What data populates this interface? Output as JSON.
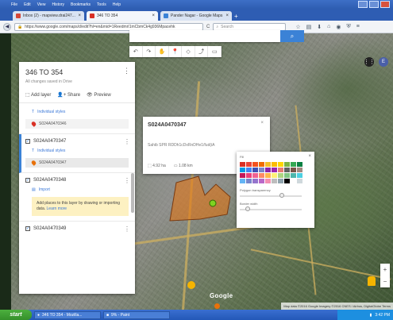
{
  "browser": {
    "menu_items": [
      "File",
      "Edit",
      "View",
      "History",
      "Bookmarks",
      "Tools",
      "Help"
    ],
    "tabs": [
      {
        "label": "Inbox (2) - mapview.drai247...",
        "color": "#d44638",
        "active": false
      },
      {
        "label": "346 TO 354",
        "color": "#d93025",
        "active": true
      },
      {
        "label": "Pander Nagar - Google Maps",
        "color": "#3b82d6",
        "active": false
      }
    ],
    "new_tab": "+",
    "url": "https://www.google.com/maps/d/edit?hl=en&mid=1ReedmrI1mCbmCk4g936Mpacehk",
    "search_placeholder": "Search",
    "reload": "C"
  },
  "panel": {
    "title": "346 TO 354",
    "subtitle": "All changes saved in Drive",
    "actions": {
      "add_layer": "Add layer",
      "share": "Share",
      "preview": "Preview"
    },
    "menu": "⋮",
    "layers": [
      {
        "name": "",
        "rows": [
          {
            "type": "link",
            "label": "Individual styles"
          },
          {
            "type": "item",
            "label": "S024A0470346",
            "pin": "#d93025"
          }
        ]
      },
      {
        "name": "S024A0470347",
        "selected": true,
        "rows": [
          {
            "type": "link",
            "label": "Individual styles"
          },
          {
            "type": "item",
            "label": "S024A0470347",
            "pin": "#e8710a"
          }
        ]
      },
      {
        "name": "S024A0470348",
        "rows": [
          {
            "type": "link",
            "label": "Import"
          }
        ],
        "tip": "Add places to this layer by drawing or importing data.",
        "tip_link": "Learn more"
      },
      {
        "name": "S024A0470349",
        "rows": []
      }
    ]
  },
  "map_toolbar": [
    "↶",
    "↷",
    "✋",
    "📍",
    "◇",
    "⤴",
    "▭"
  ],
  "map_controls": {
    "avatar": "E",
    "apps": "⋮⋮",
    "zoom_in": "+",
    "zoom_out": "−"
  },
  "info": {
    "title": "S024A0470347",
    "subtitle": "Sahib SPR RDDh1cDxRnDHe1/fud(iA",
    "area": "4.92 ha",
    "perimeter": "1.08 km",
    "edit_icon": "✎"
  },
  "picker": {
    "label": "Fill",
    "close": "×",
    "transparency_label": "Polygon transparency",
    "border_label": "Border width",
    "transparency_value": 0.7,
    "border_value": 0.1,
    "colors": [
      "#d93025",
      "#ea4335",
      "#f4511e",
      "#ef6c00",
      "#f6bf26",
      "#fbbc04",
      "#ffd600",
      "#7cb342",
      "#34a853",
      "#0b8043",
      "#039be5",
      "#4285f4",
      "#3f51b5",
      "#7986cb",
      "#8e24aa",
      "#9c27b0",
      "#e67c73",
      "#616161",
      "#795548",
      "#a1887f",
      "#c2185b",
      "#ec407a",
      "#f06292",
      "#ff8a65",
      "#ffb74d",
      "#fff176",
      "#aed581",
      "#81c784",
      "#4db6ac",
      "#4dd0e1",
      "#64b5f6",
      "#7986cb",
      "#9575cd",
      "#ba68c8",
      "#f48fb1",
      "#bdbdbd",
      "#90a4ae",
      "#000000",
      "#ffffff",
      "#cfd8dc"
    ],
    "selected_color": "#e8710a"
  },
  "map_footer": {
    "google": "Google",
    "attribution": "Map data ©2016 Google Imagery ©2016 CNES / Airbus, DigitalGlobe  Terms"
  },
  "taskbar": {
    "start": "start",
    "tasks": [
      "346 TO 354 - Mozilla...",
      "9% - Paint"
    ],
    "clock": "3:42 PM"
  }
}
